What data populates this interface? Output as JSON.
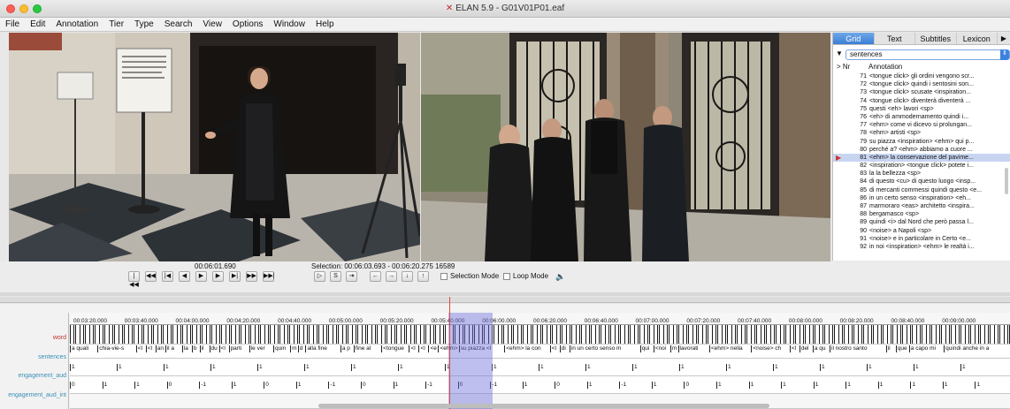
{
  "window": {
    "title": "ELAN 5.9 - G01V01P01.eaf",
    "app_icon": "elan-logo-icon"
  },
  "menubar": [
    "File",
    "Edit",
    "Annotation",
    "Tier",
    "Type",
    "Search",
    "View",
    "Options",
    "Window",
    "Help"
  ],
  "sidepanel": {
    "tabs": [
      "Grid",
      "Text",
      "Subtitles",
      "Lexicon"
    ],
    "active_tab": "Grid",
    "tier_selected": "sentences",
    "columns": {
      "nr": "Nr",
      "annotation": "Annotation"
    },
    "rows": [
      {
        "nr": "71",
        "text": "<tongue click> gli ordini vengono scr..."
      },
      {
        "nr": "72",
        "text": "<tongue click> quindi i sentosini son..."
      },
      {
        "nr": "73",
        "text": "<tongue click> scusate <inspiration..."
      },
      {
        "nr": "74",
        "text": "<tongue click> diventerà diventerà ..."
      },
      {
        "nr": "75",
        "text": "questi <eh> lavori <sp>"
      },
      {
        "nr": "76",
        "text": "<eh> di ammodernamento quindi i..."
      },
      {
        "nr": "77",
        "text": "<ehm> come vi dicevo si prolungan..."
      },
      {
        "nr": "78",
        "text": "<ehm> artisti <sp>"
      },
      {
        "nr": "79",
        "text": "su piazza <inspiration> <ehm> qui p..."
      },
      {
        "nr": "80",
        "text": "perché a? <ehm> abbiamo a cuore ..."
      },
      {
        "nr": "81",
        "text": "<ehm> la conservazione del pavime..."
      },
      {
        "nr": "82",
        "text": "<inspiration> <tongue click> potete i..."
      },
      {
        "nr": "83",
        "text": "la la bellezza <sp>"
      },
      {
        "nr": "84",
        "text": "di questo <cu> di questo luogo <insp..."
      },
      {
        "nr": "85",
        "text": "di mercanti commessi quindi questo <e..."
      },
      {
        "nr": "86",
        "text": "in un certo senso <inspiration> <eh..."
      },
      {
        "nr": "87",
        "text": "marmoraro <eas> architetto <inspira..."
      },
      {
        "nr": "88",
        "text": "bergamasco <sp>"
      },
      {
        "nr": "89",
        "text": "quindi <i> dal Nord che però passa l..."
      },
      {
        "nr": "90",
        "text": "<noise> a Napoli <sp>"
      },
      {
        "nr": "91",
        "text": "<noise> e in particolare in Certo <e..."
      },
      {
        "nr": "92",
        "text": "in noi <inspiration> <ehm> le realtà i..."
      }
    ],
    "selected_row": 10
  },
  "controls": {
    "current_time": "00:06:01.690",
    "selection_label": "Selection: 00:06:03.693 - 00:06:20.275  16589",
    "selection_mode": "Selection Mode",
    "loop_mode": "Loop Mode",
    "buttons": [
      "first-frame-icon",
      "prev-second-icon",
      "prev-frame-icon",
      "prev-step-icon",
      "play-icon",
      "next-step-icon",
      "next-frame-icon",
      "next-second-icon",
      "last-frame-icon"
    ],
    "selection_buttons": [
      "play-selection-icon",
      "S",
      "clear-selection-icon"
    ],
    "nav_buttons": [
      "←",
      "→",
      "↓",
      "↑"
    ]
  },
  "timeline": {
    "ticks": [
      "00:03:20.000",
      "00:03:40.000",
      "00:04:00.000",
      "00:04:20.000",
      "00:04:40.000",
      "00:05:00.000",
      "00:05:20.000",
      "00:05:40.000",
      "00:06:00.000",
      "00:06:20.000",
      "00:06:40.000",
      "00:07:00.000",
      "00:07:20.000",
      "00:07:40.000",
      "00:08:00.000",
      "00:08:20.000",
      "00:08:40.000",
      "00:09:00.000"
    ],
    "tiers": [
      "word",
      "sentences",
      "engagement_aud",
      "engagement_aud_int"
    ],
    "sentence_segments": [
      "a quali",
      "chia-vie-s",
      "<l",
      "<l",
      "an",
      "il a",
      "la",
      "b",
      "il",
      "du",
      "<l",
      "parti",
      "le ver",
      "quin",
      "m",
      "d",
      "alla fine",
      "a p",
      "fine al",
      "<tongue",
      "<l",
      "<l",
      "<e",
      "<ehm>",
      "su piazza <l",
      "<ehm> la con",
      "<l",
      "di",
      "in un certo senso m",
      "qui",
      "<noi",
      "m",
      "lavorati",
      "<ehm> nella",
      "<noise> ch",
      "<l",
      "del",
      "a qu",
      "il nostro santo",
      "il",
      "que",
      "a capo mi",
      "quindi anche in a"
    ],
    "eng_segments_1": [
      "1",
      "1",
      "1",
      "1",
      "1",
      "1",
      "1",
      "1",
      "1",
      "1",
      "1",
      "1",
      "1",
      "1",
      "1",
      "1",
      "1",
      "1",
      "1",
      "1"
    ],
    "eng_segments_2": [
      "0",
      "1",
      "1",
      "0",
      "-1",
      "1",
      "0",
      "1",
      "-1",
      "0",
      "1",
      "-1",
      "0",
      "-1",
      "1",
      "0",
      "1",
      "-1",
      "1",
      "0",
      "1",
      "1",
      "1",
      "1",
      "1",
      "1",
      "1",
      "1",
      "1"
    ]
  }
}
